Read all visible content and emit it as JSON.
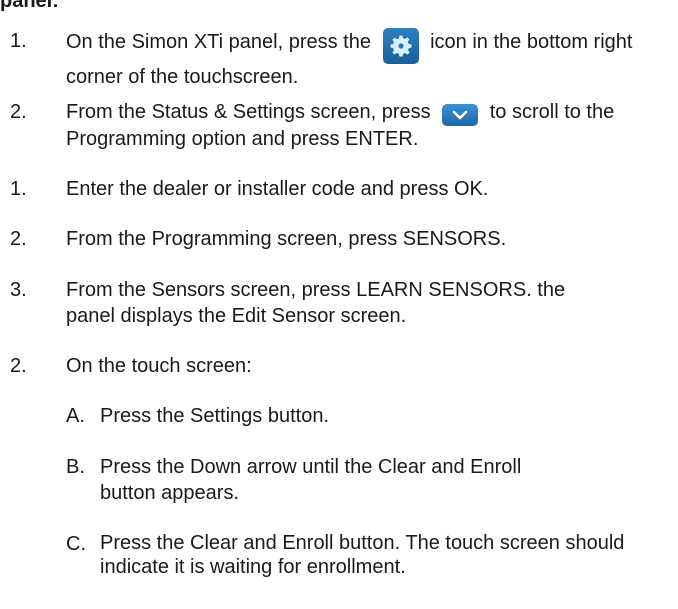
{
  "heading_partial": "panel:",
  "steps": [
    {
      "num": "1.",
      "before": "On the Simon XTi panel, press the",
      "after": "icon in the bottom right corner of the touchscreen."
    },
    {
      "num": "2.",
      "before": "From the Status & Settings screen, press",
      "after": "to scroll to the Programming option and press ENTER."
    },
    {
      "num": "1.",
      "text": "Enter the dealer or installer code and press OK."
    },
    {
      "num": "2.",
      "text": "From the Programming screen, press SENSORS."
    },
    {
      "num": "3.",
      "text": "From the Sensors screen, press LEARN SENSORS. the panel displays the Edit Sensor screen."
    },
    {
      "num": "2.",
      "text": "On the touch screen:"
    }
  ],
  "substeps": [
    {
      "letter": "A.",
      "text": "Press the Settings button."
    },
    {
      "letter": "B.",
      "text": "Press the Down arrow until the Clear and Enroll button appears."
    },
    {
      "letter": "C.",
      "text": "Press the Clear and Enroll button. The touch screen should indicate it is waiting for enrollment."
    }
  ],
  "icons": {
    "settings": "gear-icon",
    "scroll": "chevron-down-icon"
  },
  "colors": {
    "icon_blue": "#1f66aa",
    "text": "#1a1a1a"
  }
}
